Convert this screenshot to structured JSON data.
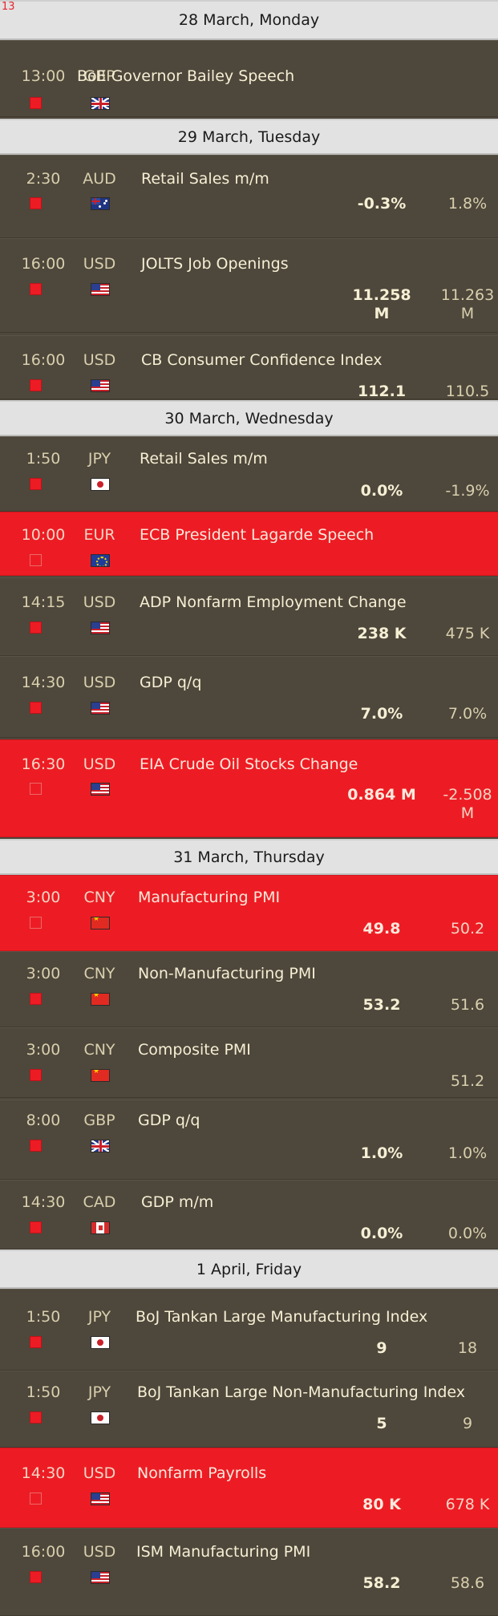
{
  "corner_label": "13",
  "days": [
    {
      "date": "28 March, Monday",
      "events": [
        {
          "time": "13:00",
          "currency": "GBP",
          "flag": "gb-flag-icon",
          "title": "BoE Governor Bailey Speech",
          "actual": "",
          "previous": "",
          "high": false
        }
      ]
    },
    {
      "date": "29 March, Tuesday",
      "events": [
        {
          "time": "2:30",
          "currency": "AUD",
          "flag": "au-flag-icon",
          "title": "Retail Sales m/m",
          "actual": "-0.3%",
          "previous": "1.8%",
          "high": false
        },
        {
          "time": "16:00",
          "currency": "USD",
          "flag": "us-flag-icon",
          "title": "JOLTS Job Openings",
          "actual": "11.258 M",
          "previous": "11.263 M",
          "high": false
        },
        {
          "time": "16:00",
          "currency": "USD",
          "flag": "us-flag-icon",
          "title": "CB Consumer Confidence Index",
          "actual": "112.1",
          "previous": "110.5",
          "high": false
        }
      ]
    },
    {
      "date": "30 March, Wednesday",
      "events": [
        {
          "time": "1:50",
          "currency": "JPY",
          "flag": "jp-flag-icon",
          "title": "Retail Sales m/m",
          "actual": "0.0%",
          "previous": "-1.9%",
          "high": false
        },
        {
          "time": "10:00",
          "currency": "EUR",
          "flag": "eu-flag-icon",
          "title": "ECB President Lagarde Speech",
          "actual": "",
          "previous": "",
          "high": true
        },
        {
          "time": "14:15",
          "currency": "USD",
          "flag": "us-flag-icon",
          "title": "ADP Nonfarm Employment Change",
          "actual": "238 K",
          "previous": "475 K",
          "high": false
        },
        {
          "time": "14:30",
          "currency": "USD",
          "flag": "us-flag-icon",
          "title": "GDP q/q",
          "actual": "7.0%",
          "previous": "7.0%",
          "high": false
        },
        {
          "time": "16:30",
          "currency": "USD",
          "flag": "us-flag-icon",
          "title": "EIA Crude Oil Stocks Change",
          "actual": "0.864 M",
          "previous": "-2.508 M",
          "high": true
        }
      ]
    },
    {
      "date": "31 March, Thursday",
      "events": [
        {
          "time": "3:00",
          "currency": "CNY",
          "flag": "cn-flag-icon",
          "title": "Manufacturing PMI",
          "actual": "49.8",
          "previous": "50.2",
          "high": true
        },
        {
          "time": "3:00",
          "currency": "CNY",
          "flag": "cn-flag-icon",
          "title": "Non-Manufacturing PMI",
          "actual": "53.2",
          "previous": "51.6",
          "high": false
        },
        {
          "time": "3:00",
          "currency": "CNY",
          "flag": "cn-flag-icon",
          "title": "Composite PMI",
          "actual": "",
          "previous": "51.2",
          "high": false
        },
        {
          "time": "8:00",
          "currency": "GBP",
          "flag": "gb-flag-icon",
          "title": "GDP q/q",
          "actual": "1.0%",
          "previous": "1.0%",
          "high": false
        },
        {
          "time": "14:30",
          "currency": "CAD",
          "flag": "ca-flag-icon",
          "title": "GDP m/m",
          "actual": "0.0%",
          "previous": "0.0%",
          "high": false
        }
      ]
    },
    {
      "date": "1 April, Friday",
      "events": [
        {
          "time": "1:50",
          "currency": "JPY",
          "flag": "jp-flag-icon",
          "title": "BoJ Tankan Large Manufacturing Index",
          "actual": "9",
          "previous": "18",
          "high": false
        },
        {
          "time": "1:50",
          "currency": "JPY",
          "flag": "jp-flag-icon",
          "title": "BoJ Tankan Large Non-Manufacturing Index",
          "actual": "5",
          "previous": "9",
          "high": false
        },
        {
          "time": "14:30",
          "currency": "USD",
          "flag": "us-flag-icon",
          "title": "Nonfarm Payrolls",
          "actual": "80 K",
          "previous": "678 K",
          "high": true
        },
        {
          "time": "16:00",
          "currency": "USD",
          "flag": "us-flag-icon",
          "title": "ISM Manufacturing PMI",
          "actual": "58.2",
          "previous": "58.6",
          "high": false
        }
      ]
    }
  ],
  "colors": {
    "background": "#4e473b",
    "high_impact": "#ed1c24",
    "day_header": "#e2e2e2",
    "text": "#f0e8cc"
  }
}
